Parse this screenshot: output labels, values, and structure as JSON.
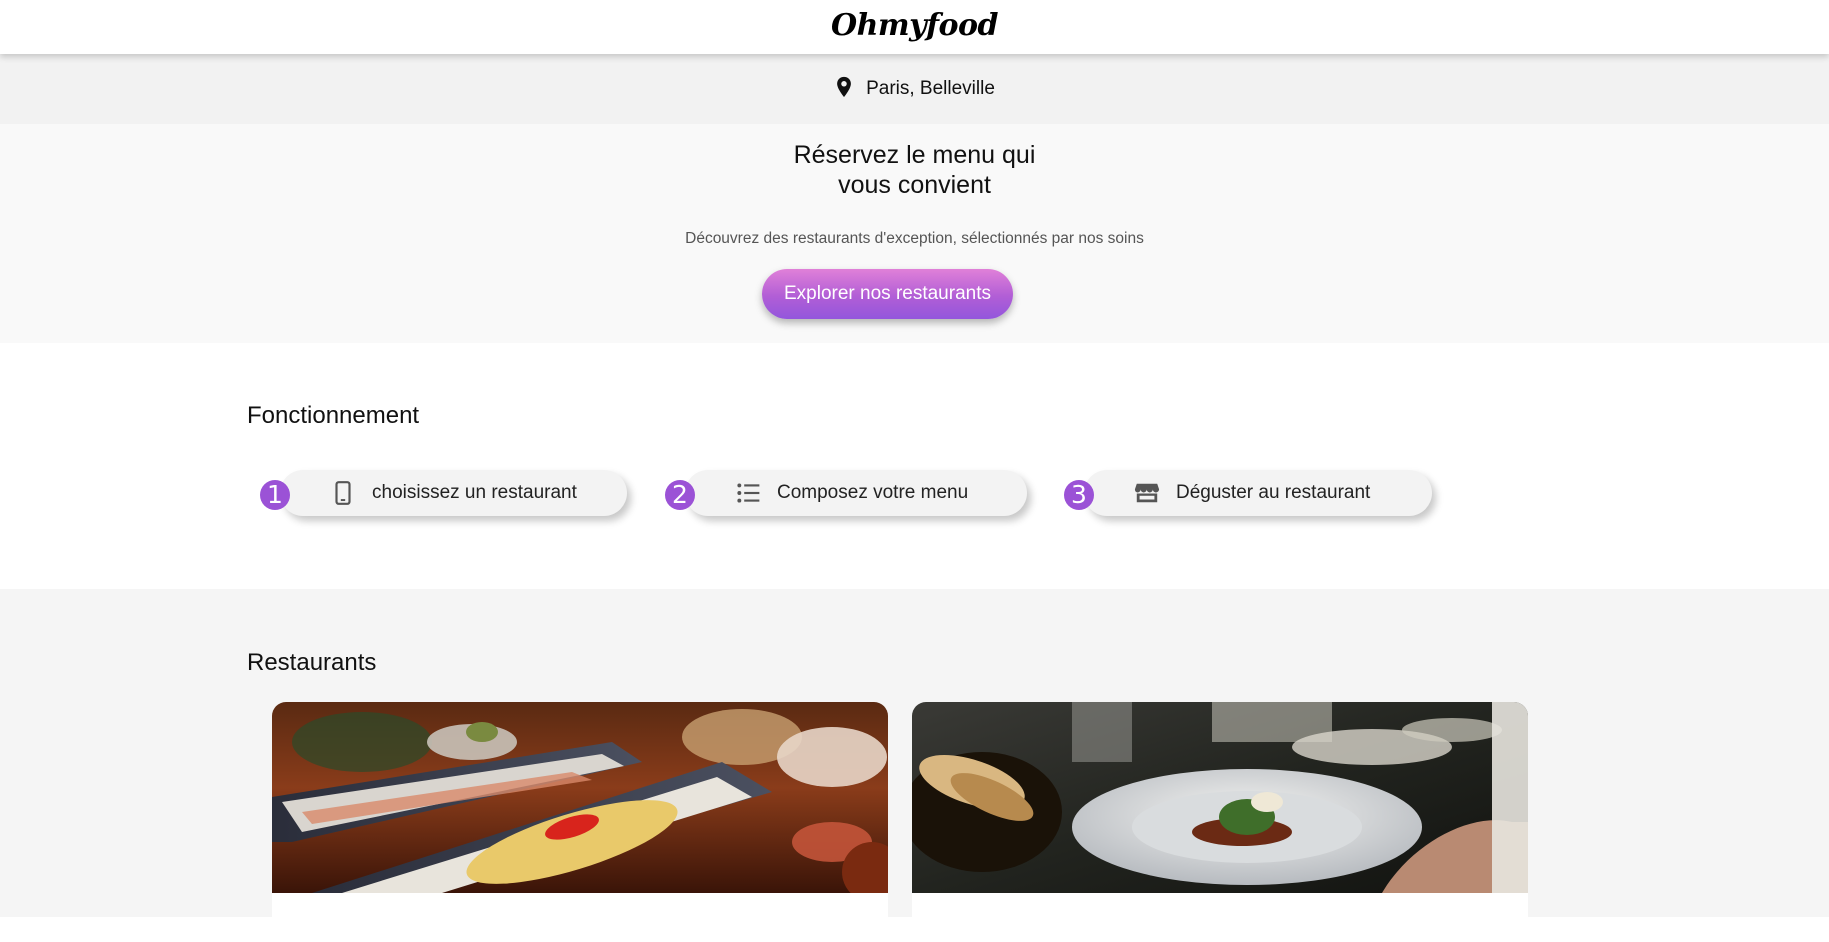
{
  "header": {
    "logo": "Ohmyfood"
  },
  "location": {
    "icon": "map-pin-icon",
    "text": "Paris, Belleville"
  },
  "hero": {
    "title_line1": "Réservez le menu qui",
    "title_line2": "vous convient",
    "subtitle": "Découvrez des restaurants d'exception, sélectionnés par nos soins",
    "cta_label": "Explorer nos restaurants"
  },
  "how_it_works": {
    "title": "Fonctionnement",
    "steps": [
      {
        "number": "1",
        "icon": "mobile-phone-icon",
        "label": "choisissez un restaurant"
      },
      {
        "number": "2",
        "icon": "list-icon",
        "label": "Composez votre menu"
      },
      {
        "number": "3",
        "icon": "store-icon",
        "label": "Déguster au restaurant"
      }
    ]
  },
  "restaurants": {
    "title": "Restaurants",
    "cards": [
      {
        "image": "fish-dish-photo",
        "name": ""
      },
      {
        "image": "plated-dish-photo",
        "name": ""
      }
    ]
  },
  "colors": {
    "accent_purple": "#9b52d6",
    "cta_gradient_top": "#e080d8",
    "cta_gradient_bottom": "#9356dc",
    "location_bar_bg": "#f2f2f2",
    "hero_bg": "#f9f9f9",
    "restaurants_bg": "#f5f5f5"
  }
}
